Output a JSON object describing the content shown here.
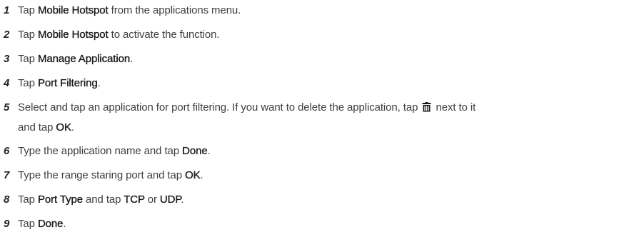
{
  "steps": [
    {
      "num": "1",
      "a": "Tap ",
      "b1": "Mobile Hotspot",
      "c": " from the applications menu."
    },
    {
      "num": "2",
      "a": "Tap ",
      "b1": "Mobile Hotspot",
      "c": " to activate the function."
    },
    {
      "num": "3",
      "a": "Tap ",
      "b1": "Manage Application",
      "c": "."
    },
    {
      "num": "4",
      "a": "Tap ",
      "b1": "Port Filtering",
      "c": "."
    },
    {
      "num": "5",
      "a": "Select and tap an application for port filtering. If you want to delete the application, tap ",
      "icon": "trash-icon",
      "c": " next to it",
      "d": "and tap ",
      "b1": "OK",
      "e": "."
    },
    {
      "num": "6",
      "a": "Type the application name and tap ",
      "b1": "Done",
      "c": "."
    },
    {
      "num": "7",
      "a": "Type the range staring port and tap ",
      "b1": "OK",
      "c": "."
    },
    {
      "num": "8",
      "a": "Tap ",
      "b1": "Port Type",
      "c": " and tap ",
      "b2": "TCP",
      "d": " or ",
      "b3": "UDP",
      "e": "."
    },
    {
      "num": "9",
      "a": "Tap ",
      "b1": "Done",
      "c": "."
    }
  ]
}
